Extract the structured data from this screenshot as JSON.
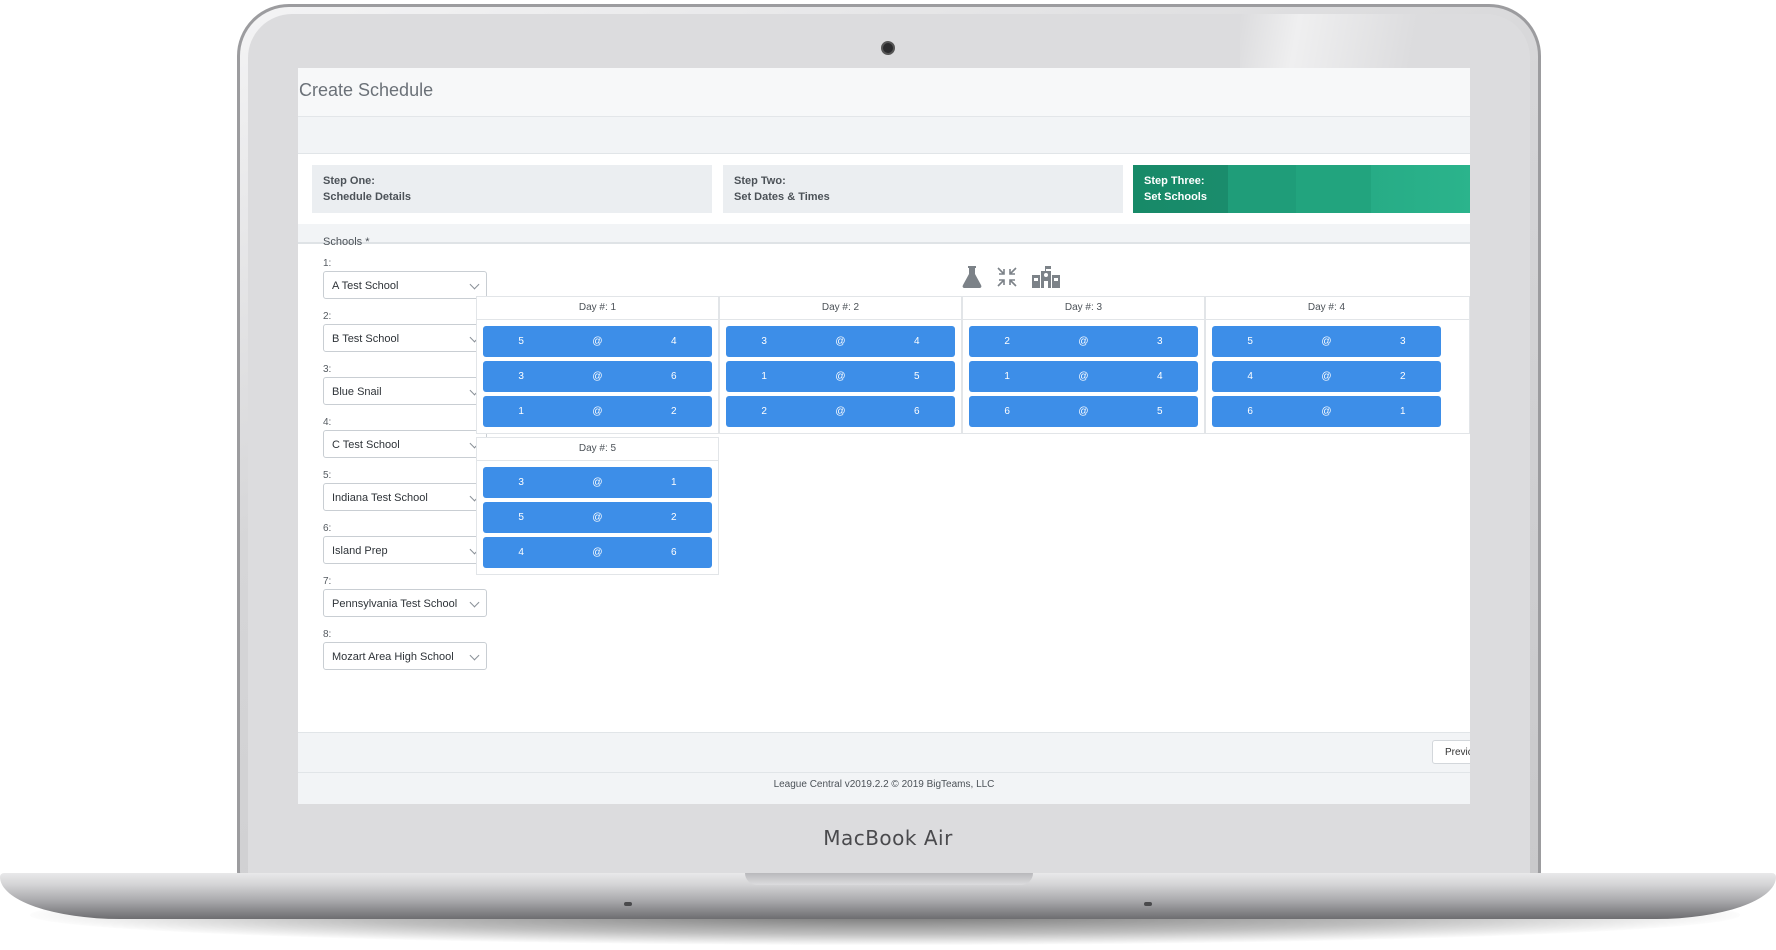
{
  "device": {
    "brand": "MacBook Air"
  },
  "page": {
    "title": "Create Schedule"
  },
  "steps": [
    {
      "label": "Step One:",
      "sub": "Schedule Details",
      "active": false
    },
    {
      "label": "Step Two:",
      "sub": "Set Dates & Times",
      "active": false
    },
    {
      "label": "Step Three:",
      "sub": "Set Schools",
      "active": true
    }
  ],
  "schools": {
    "label": "Schools *",
    "entries": [
      {
        "num": "1:",
        "value": "A Test School"
      },
      {
        "num": "2:",
        "value": "B Test School"
      },
      {
        "num": "3:",
        "value": "Blue Snail"
      },
      {
        "num": "4:",
        "value": "C Test School"
      },
      {
        "num": "5:",
        "value": "Indiana Test School"
      },
      {
        "num": "6:",
        "value": "Island Prep"
      },
      {
        "num": "7:",
        "value": "Pennsylvania Test School"
      },
      {
        "num": "8:",
        "value": "Mozart Area High School"
      }
    ]
  },
  "toolbar_icons": [
    "flask-icon",
    "compress-arrows-icon",
    "school-icon"
  ],
  "days": [
    {
      "title": "Day #: 1",
      "matches": [
        {
          "away": "5",
          "at": "@",
          "home": "4"
        },
        {
          "away": "3",
          "at": "@",
          "home": "6"
        },
        {
          "away": "1",
          "at": "@",
          "home": "2"
        }
      ]
    },
    {
      "title": "Day #: 2",
      "matches": [
        {
          "away": "3",
          "at": "@",
          "home": "4"
        },
        {
          "away": "1",
          "at": "@",
          "home": "5"
        },
        {
          "away": "2",
          "at": "@",
          "home": "6"
        }
      ]
    },
    {
      "title": "Day #: 3",
      "matches": [
        {
          "away": "2",
          "at": "@",
          "home": "3"
        },
        {
          "away": "1",
          "at": "@",
          "home": "4"
        },
        {
          "away": "6",
          "at": "@",
          "home": "5"
        }
      ]
    },
    {
      "title": "Day #: 4",
      "matches": [
        {
          "away": "5",
          "at": "@",
          "home": "3"
        },
        {
          "away": "4",
          "at": "@",
          "home": "2"
        },
        {
          "away": "6",
          "at": "@",
          "home": "1"
        }
      ]
    },
    {
      "title": "Day #: 5",
      "matches": [
        {
          "away": "3",
          "at": "@",
          "home": "1"
        },
        {
          "away": "5",
          "at": "@",
          "home": "2"
        },
        {
          "away": "4",
          "at": "@",
          "home": "6"
        }
      ]
    }
  ],
  "footer": {
    "prev_label": "Previc",
    "copyright": "League Central v2019.2.2 © 2019 BigTeams, LLC"
  },
  "colors": {
    "accent": "#1f9d79",
    "match_button": "#3d8ee8"
  }
}
